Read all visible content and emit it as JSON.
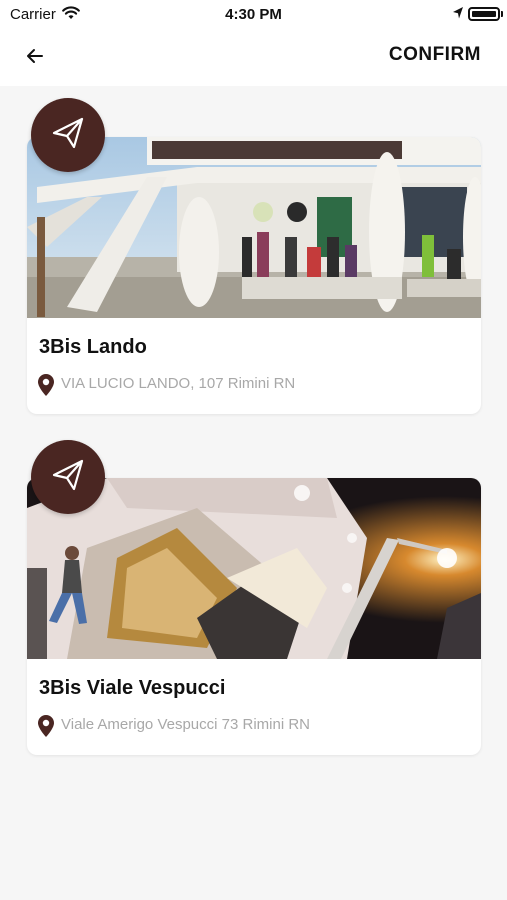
{
  "status_bar": {
    "carrier": "Carrier",
    "time": "4:30 PM"
  },
  "navbar": {
    "back_icon": "arrow-left-icon",
    "confirm_label": "CONFIRM"
  },
  "stores": [
    {
      "name": "3Bis Lando",
      "address": "VIA LUCIO LANDO, 107 Rimini RN",
      "photo": "gelateria-terrace-photo",
      "action_icon": "paper-plane-icon",
      "pin_icon": "map-pin-icon"
    },
    {
      "name": "3Bis Viale Vespucci",
      "address": "Viale Amerigo Vespucci 73 Rimini RN",
      "photo": "gelateria-night-storefront-photo",
      "action_icon": "paper-plane-icon",
      "pin_icon": "map-pin-icon"
    }
  ],
  "colors": {
    "accent": "#4a2622",
    "background": "#f6f6f6",
    "address_text": "#a8a8a8"
  }
}
